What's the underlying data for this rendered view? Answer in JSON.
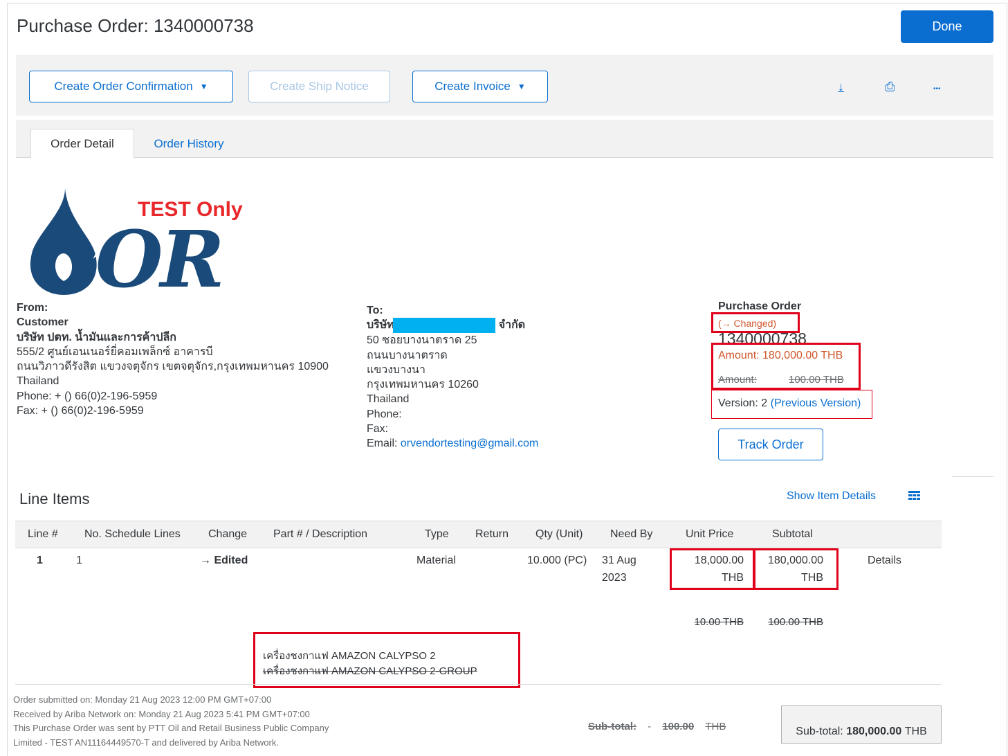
{
  "page_title": "Purchase Order: 1340000738",
  "done_label": "Done",
  "toolbar": {
    "create_order_confirmation": "Create Order Confirmation",
    "create_ship_notice": "Create Ship Notice",
    "create_invoice": "Create Invoice",
    "caret": "▼",
    "download_icon": "↓",
    "print_icon": "⎙",
    "more_icon": "•••"
  },
  "tabs": {
    "order_detail": "Order Detail",
    "order_history": "Order History"
  },
  "logo": {
    "test_only": "TEST Only",
    "brand_text": "OR"
  },
  "from": {
    "heading": "From:",
    "name": "Customer",
    "company": "บริษัท ปตท. น้ำมันและการค้าปลีก",
    "address1": "555/2 ศูนย์เอนเนอร์ยี่คอมเพล็กซ์ อาคารบี",
    "address2": "ถนนวิภาวดีรังสิต แขวงจตุจักร เขตจตุจักร,กรุงเทพมหานคร 10900",
    "country": "Thailand",
    "phone": "Phone:  + () 66(0)2-196-5959",
    "fax": "Fax:  + () 66(0)2-196-5959"
  },
  "to": {
    "heading": "To:",
    "company_prefix": "บริษัท",
    "company_suffix": "จำกัด",
    "redaction_color": "#00b0f0",
    "address1": "50 ซอยบางนาตราด 25",
    "address2": "ถนนบางนาตราด",
    "address3": "แขวงบางนา",
    "address4": "กรุงเทพมหานคร 10260",
    "country": "Thailand",
    "phone": "Phone:",
    "fax": "Fax:",
    "email_label": "Email:",
    "email": "orvendortesting@gmail.com"
  },
  "po": {
    "heading": "Purchase Order",
    "changed": "(→ Changed)",
    "number": "1340000738",
    "amount_new": "Amount: 180,000.00 THB",
    "amount_old_label": "Amount:",
    "amount_old_value": "100.00 THB",
    "version": "Version: 2",
    "previous_version": "(Previous Version)",
    "track_order": "Track Order"
  },
  "line_items": {
    "title": "Line Items",
    "show_item_details": "Show Item Details",
    "columns": [
      "Line #",
      "No. Schedule Lines",
      "Change",
      "Part # / Description",
      "Type",
      "Return",
      "Qty (Unit)",
      "Need By",
      "Unit Price",
      "Subtotal"
    ],
    "rows": [
      {
        "line": "1",
        "schedule_lines": "1",
        "change": "→ Edited",
        "type": "Material",
        "qty": "10.000 (PC)",
        "need_by_1": "31 Aug",
        "need_by_2": "2023",
        "unit_price_1": "18,000.00",
        "unit_price_2": "THB",
        "subtotal_1": "180,000.00",
        "subtotal_2": "THB",
        "details": "Details",
        "old_unit_price": "10.00 THB",
        "old_subtotal": "100.00 THB",
        "desc_new": "เครื่องชงกาแฟ AMAZON CALYPSO 2",
        "desc_old": "เครื่องชงกาแฟ AMAZON CALYPSO 2-GROUP"
      }
    ]
  },
  "footer": {
    "submitted": "Order submitted on: Monday 21 Aug 2023 12:00 PM GMT+07:00",
    "received": "Received by Ariba Network on: Monday 21 Aug 2023 5:41 PM GMT+07:00",
    "sent_by_1": "This Purchase Order was sent by PTT Oil and Retail Business Public Company",
    "sent_by_2": "Limited - TEST AN11164449570-T and delivered by Ariba Network.",
    "old_subtotal_label": "Sub-total:",
    "old_subtotal_dash": "-",
    "old_subtotal_value": "100.00",
    "old_subtotal_currency": "THB",
    "subtotal_label": "Sub-total:",
    "subtotal_value": "180,000.00",
    "subtotal_currency": "THB"
  },
  "colors": {
    "accent": "#0a6ed1",
    "changed": "#d0562c",
    "highlight_box": "#e0001b",
    "logo_blue": "#1a4a7a",
    "test_red": "#e8272a"
  }
}
